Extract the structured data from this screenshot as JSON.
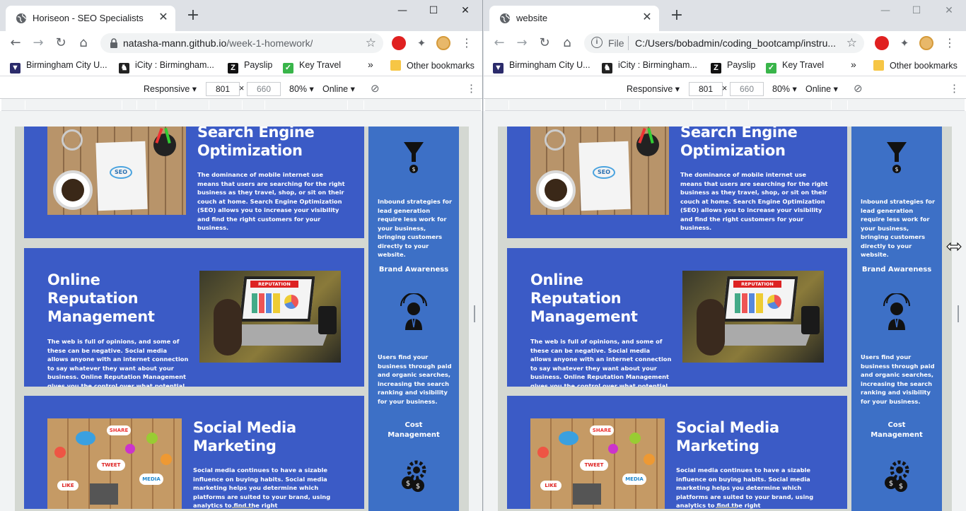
{
  "left_window": {
    "tab_title": "Horiseon - SEO Specialists",
    "url_host": "natasha-mann.github.io",
    "url_path": "/week-1-homework/"
  },
  "right_window": {
    "tab_title": "website",
    "url_scheme_label": "File",
    "url_path": "C:/Users/bobadmin/coding_bootcamp/instru..."
  },
  "window_controls": {
    "minimize": "—",
    "maximize": "☐",
    "close": "✕"
  },
  "bookmarks": [
    {
      "label": "Birmingham City U...",
      "icon": "bcu-icon"
    },
    {
      "label": "iCity : Birmingham...",
      "icon": "icity-icon"
    },
    {
      "label": "Payslip",
      "icon": "payslip-icon"
    },
    {
      "label": "Key Travel",
      "icon": "keytravel-icon"
    }
  ],
  "bookmarks_overflow": "»",
  "other_bookmarks": "Other bookmarks",
  "device_toolbar": {
    "mode": "Responsive",
    "width": "801",
    "times": "×",
    "height": "660",
    "zoom": "80%",
    "network": "Online"
  },
  "page": {
    "cards": [
      {
        "title_line1": "Search Engine",
        "title_line2": "Optimization",
        "body": "The dominance of mobile internet use means that users are searching for the right business as they travel, shop, or sit on their couch at home. Search Engine Optimization (SEO) allows you to increase your visibility and find the right customers for your business.",
        "image_alt": "seo-desk-image"
      },
      {
        "title_line1": "Online",
        "title_line2": "Reputation",
        "title_line3": "Management",
        "body": "The web is full of opinions, and some of these can be negative. Social media allows anyone with an internet connection to say whatever they want about your business. Online Reputation Management gives you the control over what potential customers see when they search for your business.",
        "image_alt": "reputation-laptop-image"
      },
      {
        "title_line1": "Social Media",
        "title_line2": "Marketing",
        "body": "Social media continues to have a sizable influence on buying habits. Social media marketing helps you determine which platforms are suited to your brand, using analytics to find the right",
        "image_alt": "social-media-image"
      }
    ],
    "aside": {
      "lead_text": "Inbound strategies for lead generation require less work for your business, bringing customers directly to your website.",
      "brand_heading": "Brand Awareness",
      "brand_text": "Users find your business through paid and organic searches, increasing the search ranking and visibility for your business.",
      "cost_heading": "Cost Management"
    }
  }
}
